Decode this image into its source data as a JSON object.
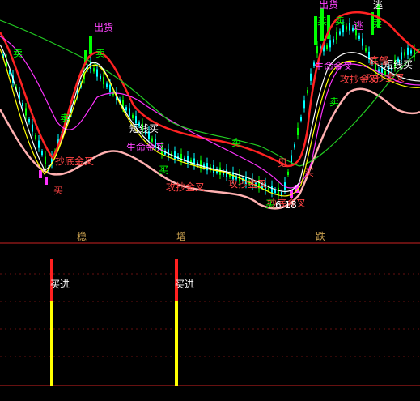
{
  "chart_data": [
    {
      "type": "line",
      "panel": "price",
      "annotations": [
        {
          "text": "出货",
          "color": "#ff44ff"
        },
        {
          "text": "出货",
          "color": "#ff44ff"
        },
        {
          "text": "逃",
          "color": "#ff44ff"
        },
        {
          "text": "逃",
          "color": "#ffffff"
        },
        {
          "text": "卖",
          "color": "#00ff00"
        },
        {
          "text": "卖",
          "color": "#00ff00"
        },
        {
          "text": "卖",
          "color": "#00ff00"
        },
        {
          "text": "卖",
          "color": "#00ff00"
        },
        {
          "text": "卖",
          "color": "#00ff00"
        },
        {
          "text": "卖",
          "color": "#00ff00"
        },
        {
          "text": "卖",
          "color": "#00ff00"
        },
        {
          "text": "卖",
          "color": "#00ff00"
        },
        {
          "text": "买",
          "color": "#ff4444"
        },
        {
          "text": "买",
          "color": "#00ff00"
        },
        {
          "text": "买",
          "color": "#ff4444"
        },
        {
          "text": "买",
          "color": "#00ff00"
        },
        {
          "text": "见",
          "color": "#ff4444"
        },
        {
          "text": "抄底金叉",
          "color": "#ff4444"
        },
        {
          "text": "抄底金叉",
          "color": "#ff4444"
        },
        {
          "text": "生命金叉",
          "color": "#ff44ff"
        },
        {
          "text": "生命金叉",
          "color": "#ff44ff"
        },
        {
          "text": "短线买",
          "color": "#ffffff"
        },
        {
          "text": "短线买",
          "color": "#ffffff"
        },
        {
          "text": "攻抄金叉",
          "color": "#ff4444"
        },
        {
          "text": "攻抄金叉",
          "color": "#ff4444"
        },
        {
          "text": "攻抄金叉",
          "color": "#ff4444"
        },
        {
          "text": "攻抄金叉",
          "color": "#ff4444"
        },
        {
          "text": "底部",
          "color": "#ff4444"
        },
        {
          "text": "6.18",
          "color": "#ffffff"
        }
      ],
      "series_colors": [
        "#ff2222",
        "#ffb0b0",
        "#ff33ff",
        "#22cc22",
        "#ffffff",
        "#ffff00"
      ]
    },
    {
      "type": "bar",
      "panel": "indicator",
      "section_labels": [
        "稳",
        "增",
        "跌"
      ],
      "signals": [
        {
          "label": "买进",
          "value": 1
        },
        {
          "label": "买进",
          "value": 1
        }
      ],
      "colors": {
        "upper": "#ff2020",
        "lower": "#ffff00"
      }
    }
  ]
}
